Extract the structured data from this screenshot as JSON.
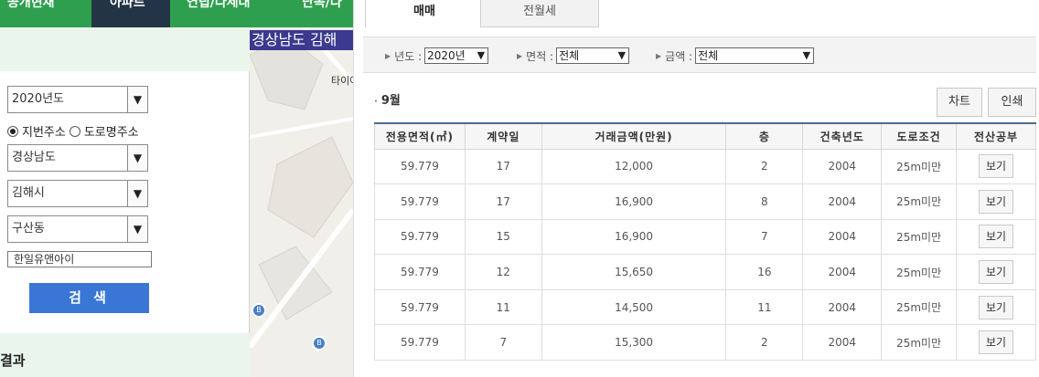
{
  "topnav": {
    "tabs": [
      "공개현재",
      "아파트",
      "연립/다세대",
      "단독/다"
    ],
    "active_index": 1
  },
  "left_panel": {
    "year_select": "2020년도",
    "radio_options": [
      {
        "label": "지번주소",
        "checked": true
      },
      {
        "label": "도로명주소",
        "checked": false
      }
    ],
    "province_select": "경상남도",
    "city_select": "김해시",
    "dong_select": "구산동",
    "apartment_input": "한일유앤아이",
    "search_button": "검 색",
    "results_label": "결과"
  },
  "map": {
    "title": "경상남도 김해",
    "place_label": "타이어"
  },
  "main": {
    "tabs": [
      "매매",
      "전월세"
    ],
    "filters": [
      {
        "label": "년도 :",
        "value": "2020년"
      },
      {
        "label": "면적 :",
        "value": "전체"
      },
      {
        "label": "금액 :",
        "value": "전체"
      }
    ],
    "month_label": "9월",
    "chart_button": "차트",
    "print_button": "인쇄",
    "table": {
      "headers": [
        "전용면적(㎡)",
        "계약일",
        "거래금액(만원)",
        "층",
        "건축년도",
        "도로조건",
        "전산공부"
      ],
      "rows": [
        [
          "59.779",
          "17",
          "12,000",
          "2",
          "2004",
          "25m미만",
          "보기"
        ],
        [
          "59.779",
          "17",
          "16,900",
          "8",
          "2004",
          "25m미만",
          "보기"
        ],
        [
          "59.779",
          "15",
          "16,900",
          "7",
          "2004",
          "25m미만",
          "보기"
        ],
        [
          "59.779",
          "12",
          "15,650",
          "16",
          "2004",
          "25m미만",
          "보기"
        ],
        [
          "59.779",
          "11",
          "14,500",
          "11",
          "2004",
          "25m미만",
          "보기"
        ],
        [
          "59.779",
          "7",
          "15,300",
          "2",
          "2004",
          "25m미만",
          "보기"
        ]
      ]
    }
  }
}
